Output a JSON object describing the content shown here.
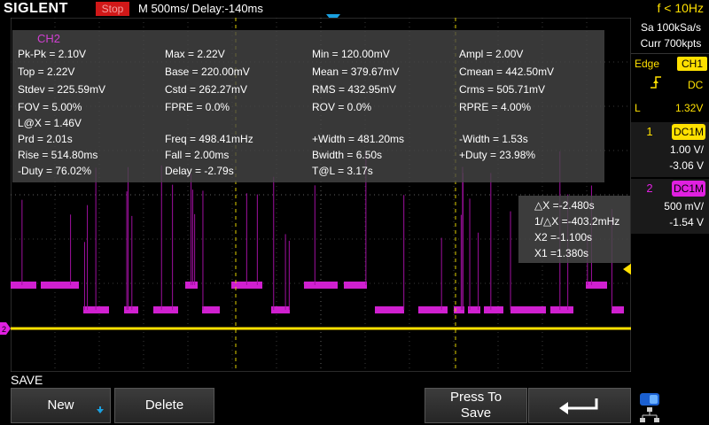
{
  "topbar": {
    "brand": "SIGLENT",
    "run_state": "Stop",
    "timebase": "M 500ms/  Delay:-140ms",
    "freq_counter": "f < 10Hz"
  },
  "acquisition": {
    "sample_rate": "Sa 100kSa/s",
    "memory": "Curr 700kpts"
  },
  "trigger": {
    "type": "Edge",
    "source": "CH1",
    "coupling": "DC",
    "level_label": "L",
    "level": "1.32V"
  },
  "channels": [
    {
      "num": "1",
      "coupling": "DC1M",
      "scale": "1.00 V/",
      "offset": "-3.06 V",
      "color": "#ffe000"
    },
    {
      "num": "2",
      "coupling": "DC1M",
      "scale": "500 mV/",
      "offset": "-1.54 V",
      "color": "#e020e0"
    }
  ],
  "measurements": {
    "title": "CH2",
    "items": [
      "Pk-Pk = 2.10V",
      "Max = 2.22V",
      "Min = 120.00mV",
      "Ampl = 2.00V",
      "Top = 2.22V",
      "Base = 220.00mV",
      "Mean = 379.67mV",
      "Cmean = 442.50mV",
      "Stdev = 225.59mV",
      "Cstd = 262.27mV",
      "RMS = 432.95mV",
      "Crms = 505.71mV",
      "FOV = 5.00%",
      "FPRE = 0.0%",
      "ROV = 0.0%",
      "RPRE = 4.00%",
      "L@X = 1.46V",
      "",
      "",
      "",
      "Prd = 2.01s",
      "Freq = 498.41mHz",
      "+Width = 481.20ms",
      "-Width = 1.53s",
      "Rise = 514.80ms",
      "Fall = 2.00ms",
      "Bwidth = 6.50s",
      "+Duty = 23.98%",
      "-Duty = 76.02%",
      "Delay = -2.79s",
      "T@L = 3.17s",
      ""
    ]
  },
  "cursors": {
    "delta_x": "△X =-2.480s",
    "inv_delta_x": "1/△X =-403.2mHz",
    "x2": "X2 =-1.100s",
    "x1": "X1 =1.380s"
  },
  "menu": {
    "title": "SAVE",
    "new_label": "New",
    "delete_label": "Delete",
    "press_to_save_label": "Press To Save"
  },
  "icons": {
    "return": "return-arrow-icon",
    "network": "network-icon",
    "toggle": "toggle-icon"
  }
}
